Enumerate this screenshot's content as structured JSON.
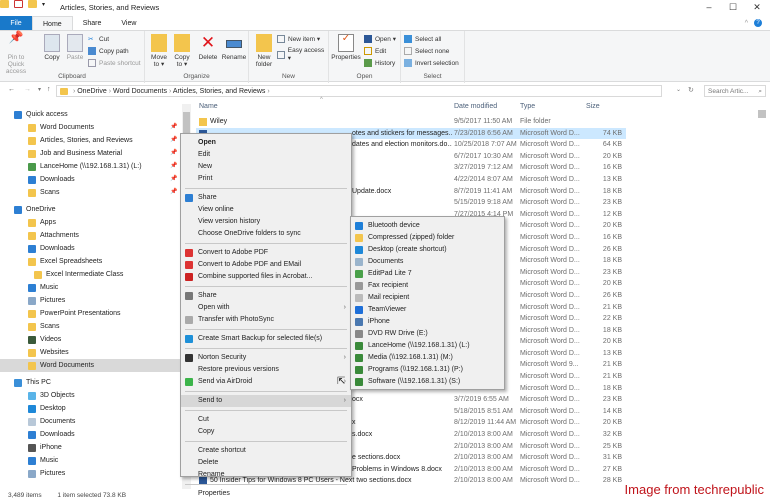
{
  "window": {
    "title": "Articles, Stories, and Reviews",
    "minimize": "–",
    "maximize": "☐",
    "close": "✕"
  },
  "tabs": [
    "File",
    "Home",
    "Share",
    "View"
  ],
  "ribbon": {
    "clipboard": {
      "label": "Clipboard",
      "pin": "Pin to Quick access",
      "copy": "Copy",
      "paste": "Paste",
      "cut": "Cut",
      "copy_path": "Copy path",
      "paste_shortcut": "Paste shortcut"
    },
    "organize": {
      "label": "Organize",
      "move_to": "Move to ▾",
      "copy_to": "Copy to ▾",
      "delete": "Delete",
      "rename": "Rename"
    },
    "new": {
      "label": "New",
      "new_folder": "New folder",
      "new_item": "New item ▾",
      "easy_access": "Easy access ▾"
    },
    "open": {
      "label": "Open",
      "properties": "Properties",
      "open": "Open ▾",
      "edit": "Edit",
      "history": "History"
    },
    "select": {
      "label": "Select",
      "select_all": "Select all",
      "select_none": "Select none",
      "invert": "Invert selection"
    }
  },
  "address": {
    "path": [
      "OneDrive",
      "Word Documents",
      "Articles, Stories, and Reviews"
    ],
    "search_placeholder": "Search Artic..."
  },
  "nav": [
    {
      "label": "Quick access",
      "type": "hdr",
      "icon": "star-icon",
      "color": "#2d7fd3"
    },
    {
      "label": "Word Documents",
      "icon": "folder-icon",
      "color": "#f3c54d",
      "pinned": true
    },
    {
      "label": "Articles, Stories, and Reviews",
      "icon": "folder-icon",
      "color": "#f3c54d",
      "pinned": true
    },
    {
      "label": "Job and Business Material",
      "icon": "folder-icon",
      "color": "#f3c54d",
      "pinned": true
    },
    {
      "label": "LanceHome (\\\\192.168.1.31) (L:)",
      "icon": "network-drive-icon",
      "color": "#4a9a4a",
      "pinned": true
    },
    {
      "label": "Downloads",
      "icon": "downloads-icon",
      "color": "#2d7fd3",
      "pinned": true
    },
    {
      "label": "Scans",
      "icon": "folder-icon",
      "color": "#f3c54d",
      "pinned": true
    },
    {
      "label": "OneDrive",
      "type": "hdr",
      "icon": "cloud-icon",
      "color": "#2d7fd3"
    },
    {
      "label": "Apps",
      "icon": "folder-icon",
      "color": "#f3c54d"
    },
    {
      "label": "Attachments",
      "icon": "folder-icon",
      "color": "#f3c54d"
    },
    {
      "label": "Downloads",
      "icon": "downloads-icon",
      "color": "#2d7fd3"
    },
    {
      "label": "Excel Spreadsheets",
      "icon": "folder-icon",
      "color": "#f3c54d"
    },
    {
      "label": "Excel Intermediate Class",
      "icon": "folder-icon",
      "color": "#f3c54d",
      "indent": true
    },
    {
      "label": "Music",
      "icon": "music-icon",
      "color": "#2d7fd3"
    },
    {
      "label": "Pictures",
      "icon": "pictures-icon",
      "color": "#8aa8c8"
    },
    {
      "label": "PowerPoint Presentations",
      "icon": "folder-icon",
      "color": "#f3c54d"
    },
    {
      "label": "Scans",
      "icon": "folder-icon",
      "color": "#f3c54d"
    },
    {
      "label": "Videos",
      "icon": "videos-icon",
      "color": "#3a5a3a"
    },
    {
      "label": "Websites",
      "icon": "folder-icon",
      "color": "#f3c54d"
    },
    {
      "label": "Word Documents",
      "icon": "folder-icon",
      "color": "#f3c54d",
      "selected": true
    },
    {
      "label": "This PC",
      "type": "hdr",
      "icon": "computer-icon",
      "color": "#3a8fd8"
    },
    {
      "label": "3D Objects",
      "icon": "3d-objects-icon",
      "color": "#5ab4e8"
    },
    {
      "label": "Desktop",
      "icon": "desktop-icon",
      "color": "#1e88d8"
    },
    {
      "label": "Documents",
      "icon": "documents-icon",
      "color": "#b8c8d8"
    },
    {
      "label": "Downloads",
      "icon": "downloads-icon",
      "color": "#2d7fd3"
    },
    {
      "label": "iPhone",
      "icon": "phone-icon",
      "color": "#555"
    },
    {
      "label": "Music",
      "icon": "music-icon",
      "color": "#2d7fd3"
    },
    {
      "label": "Pictures",
      "icon": "pictures-icon",
      "color": "#8aa8c8"
    }
  ],
  "columns": {
    "name": "Name",
    "date": "Date modified",
    "type": "Type",
    "size": "Size"
  },
  "files": [
    {
      "name": "Wiley",
      "date": "9/5/2017 11:50 AM",
      "type": "File folder",
      "size": "",
      "folder": true
    },
    {
      "frag": "otes and stickers for messages....",
      "date": "7/23/2018 6:56 AM",
      "type": "Microsoft Word D...",
      "size": "74 KB",
      "selected": true
    },
    {
      "frag": "dates and election monitors.do...",
      "date": "10/25/2018 7:07 AM",
      "type": "Microsoft Word D...",
      "size": "64 KB"
    },
    {
      "date": "6/7/2017 10:30 AM",
      "type": "Microsoft Word D...",
      "size": "20 KB"
    },
    {
      "date": "3/27/2019 7:12 AM",
      "type": "Microsoft Word D...",
      "size": "16 KB"
    },
    {
      "date": "4/22/2014 8:07 AM",
      "type": "Microsoft Word D...",
      "size": "13 KB"
    },
    {
      "frag": "Update.docx",
      "date": "8/7/2019 11:41 AM",
      "type": "Microsoft Word D...",
      "size": "18 KB"
    },
    {
      "date": "5/15/2019 9:18 AM",
      "type": "Microsoft Word D...",
      "size": "23 KB"
    },
    {
      "date": "7/27/2015 4:14 PM",
      "type": "Microsoft Word D...",
      "size": "12 KB"
    },
    {
      "type": "Microsoft Word D...",
      "size": "20 KB"
    },
    {
      "type": "Microsoft Word D...",
      "size": "16 KB"
    },
    {
      "type": "Microsoft Word D...",
      "size": "26 KB"
    },
    {
      "type": "Microsoft Word D...",
      "size": "18 KB"
    },
    {
      "type": "Microsoft Word D...",
      "size": "23 KB"
    },
    {
      "type": "Microsoft Word D...",
      "size": "20 KB"
    },
    {
      "type": "Microsoft Word D...",
      "size": "26 KB"
    },
    {
      "type": "Microsoft Word D...",
      "size": "21 KB"
    },
    {
      "type": "Microsoft Word D...",
      "size": "22 KB"
    },
    {
      "type": "Microsoft Word D...",
      "size": "18 KB"
    },
    {
      "type": "Microsoft Word D...",
      "size": "20 KB"
    },
    {
      "type": "Microsoft Word D...",
      "size": "13 KB"
    },
    {
      "type": "Microsoft Word 9...",
      "size": "21 KB"
    },
    {
      "type": "Microsoft Word D...",
      "size": "21 KB"
    },
    {
      "type": "Microsoft Word D...",
      "size": "18 KB"
    },
    {
      "frag": "ocx",
      "date": "3/7/2019 6:55 AM",
      "type": "Microsoft Word D...",
      "size": "23 KB"
    },
    {
      "date": "5/18/2015 8:51 AM",
      "type": "Microsoft Word D...",
      "size": "14 KB"
    },
    {
      "frag": "x",
      "date": "8/12/2019 11:44 AM",
      "type": "Microsoft Word D...",
      "size": "20 KB"
    },
    {
      "frag": "s.docx",
      "date": "2/10/2013 8:00 AM",
      "type": "Microsoft Word D...",
      "size": "32 KB"
    },
    {
      "date": "2/10/2013 8:00 AM",
      "type": "Microsoft Word D...",
      "size": "25 KB"
    },
    {
      "frag": "e sections.docx",
      "date": "2/10/2013 8:00 AM",
      "type": "Microsoft Word D...",
      "size": "31 KB"
    },
    {
      "frag": "Problems in Windows 8.docx",
      "date": "2/10/2013 8:00 AM",
      "type": "Microsoft Word D...",
      "size": "27 KB"
    },
    {
      "name": "50 Insider Tips for Windows 8 PC Users - Next two sections.docx",
      "date": "2/10/2013 8:00 AM",
      "type": "Microsoft Word D...",
      "size": "28 KB"
    }
  ],
  "context_menu": [
    {
      "label": "Open",
      "bold": true
    },
    {
      "label": "Edit"
    },
    {
      "label": "New"
    },
    {
      "label": "Print"
    },
    {
      "sep": true
    },
    {
      "label": "Share",
      "icon": "onedrive-icon",
      "color": "#2d7fd3"
    },
    {
      "label": "View online"
    },
    {
      "label": "View version history"
    },
    {
      "label": "Choose OneDrive folders to sync"
    },
    {
      "sep": true
    },
    {
      "label": "Convert to Adobe PDF",
      "icon": "adobe-pdf-icon",
      "color": "#d33"
    },
    {
      "label": "Convert to Adobe PDF and EMail",
      "icon": "adobe-email-icon",
      "color": "#d33"
    },
    {
      "label": "Combine supported files in Acrobat...",
      "icon": "acrobat-icon",
      "color": "#c22"
    },
    {
      "sep": true
    },
    {
      "label": "Share",
      "icon": "share-icon",
      "color": "#777"
    },
    {
      "label": "Open with",
      "submenu": true
    },
    {
      "label": "Transfer with PhotoSync",
      "icon": "wifi-icon",
      "color": "#aaa"
    },
    {
      "sep": true
    },
    {
      "label": "Create Smart Backup for selected file(s)",
      "icon": "backup-icon",
      "color": "#1e90d8"
    },
    {
      "sep": true
    },
    {
      "label": "Norton Security",
      "icon": "norton-icon",
      "color": "#333",
      "submenu": true
    },
    {
      "label": "Restore previous versions"
    },
    {
      "label": "Send via AirDroid",
      "icon": "airdroid-icon",
      "color": "#3cb44a",
      "submenu": true
    },
    {
      "sep": true
    },
    {
      "label": "Send to",
      "submenu": true,
      "highlighted": true
    },
    {
      "sep": true
    },
    {
      "label": "Cut"
    },
    {
      "label": "Copy"
    },
    {
      "sep": true
    },
    {
      "label": "Create shortcut"
    },
    {
      "label": "Delete"
    },
    {
      "label": "Rename"
    },
    {
      "sep": true
    },
    {
      "label": "Properties"
    }
  ],
  "send_to": [
    {
      "label": "Bluetooth device",
      "icon": "bluetooth-icon",
      "color": "#1e7fd8"
    },
    {
      "label": "Compressed (zipped) folder",
      "icon": "zip-folder-icon",
      "color": "#f3c54d"
    },
    {
      "label": "Desktop (create shortcut)",
      "icon": "desktop-icon",
      "color": "#1e88d8"
    },
    {
      "label": "Documents",
      "icon": "documents-icon",
      "color": "#9ab4cc"
    },
    {
      "label": "EditPad Lite 7",
      "icon": "editpad-icon",
      "color": "#4aa04a"
    },
    {
      "label": "Fax recipient",
      "icon": "fax-icon",
      "color": "#999"
    },
    {
      "label": "Mail recipient",
      "icon": "mail-icon",
      "color": "#bbb"
    },
    {
      "label": "TeamViewer",
      "icon": "teamviewer-icon",
      "color": "#1e6fd8"
    },
    {
      "label": "iPhone",
      "icon": "phone-icon",
      "color": "#4a78b0"
    },
    {
      "label": "DVD RW Drive (E:)",
      "icon": "dvd-drive-icon",
      "color": "#888"
    },
    {
      "label": "LanceHome (\\\\192.168.1.31) (L:)",
      "icon": "network-drive-icon",
      "color": "#3a8a3a"
    },
    {
      "label": "Media (\\\\192.168.1.31) (M:)",
      "icon": "network-drive-icon",
      "color": "#3a8a3a"
    },
    {
      "label": "Programs (\\\\192.168.1.31) (P:)",
      "icon": "network-drive-icon",
      "color": "#3a8a3a"
    },
    {
      "label": "Software (\\\\192.168.1.31) (S:)",
      "icon": "network-drive-icon",
      "color": "#3a8a3a"
    }
  ],
  "status": {
    "items": "3,489 items",
    "selected": "1 item selected  73.8 KB"
  },
  "credit": "Image from techrepublic"
}
